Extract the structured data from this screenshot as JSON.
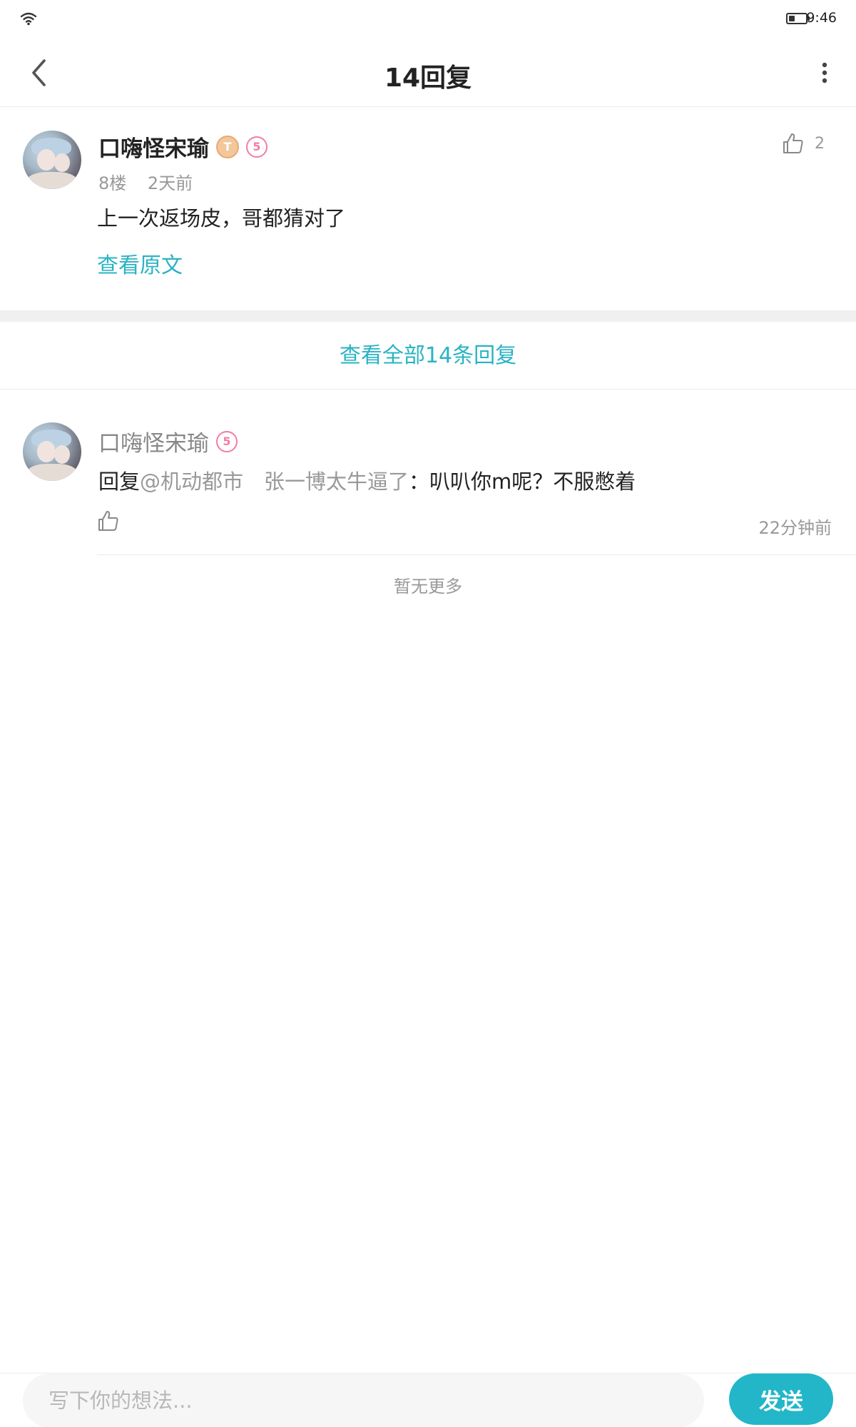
{
  "status_bar": {
    "time": "9:46",
    "battery_level": 0.3,
    "icons": [
      "wifi-icon",
      "battery-icon"
    ]
  },
  "header": {
    "title": "14回复",
    "back_icon": "chevron-left-icon",
    "more_icon": "more-vertical-icon"
  },
  "main_comment": {
    "username": "口嗨怪宋瑜",
    "level_badge": "T",
    "vip_badge": "5",
    "floor": "8楼",
    "time": "2天前",
    "text": "上一次返场皮，哥都猜对了",
    "view_original": "查看原文",
    "like_count": "2"
  },
  "view_all_replies": "查看全部14条回复",
  "reply": {
    "username": "口嗨怪宋瑜",
    "vip_badge": "5",
    "prefix": "回复",
    "mention": "@机动都市　张一博太牛逼了",
    "colon": "：",
    "body": "叭叭你m呢？不服憋着",
    "time": "22分钟前"
  },
  "no_more": "暂无更多",
  "composer": {
    "placeholder": "写下你的想法...",
    "send_label": "发送"
  },
  "colors": {
    "accent": "#29b3c3",
    "send_button": "#22b6c8",
    "muted_text": "#999999"
  }
}
